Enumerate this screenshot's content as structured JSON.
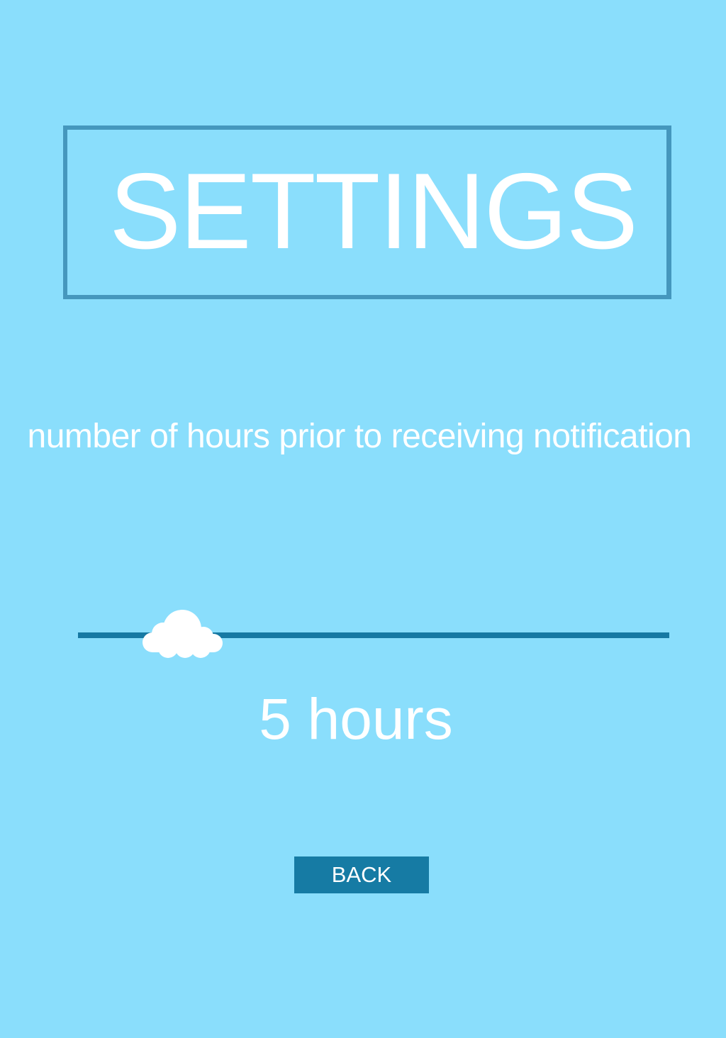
{
  "header": {
    "title": "SETTINGS"
  },
  "setting": {
    "description": "number of hours prior to receiving notification",
    "slider": {
      "min": 1,
      "max": 24,
      "value": 5,
      "thumb_icon": "cloud-icon"
    },
    "value_label": "5 hours"
  },
  "actions": {
    "back_label": "BACK"
  },
  "colors": {
    "background": "#8ADEFC",
    "title_border": "#4597BD",
    "track": "#1679A3",
    "button": "#167BA4",
    "text": "#FFFFFF"
  }
}
